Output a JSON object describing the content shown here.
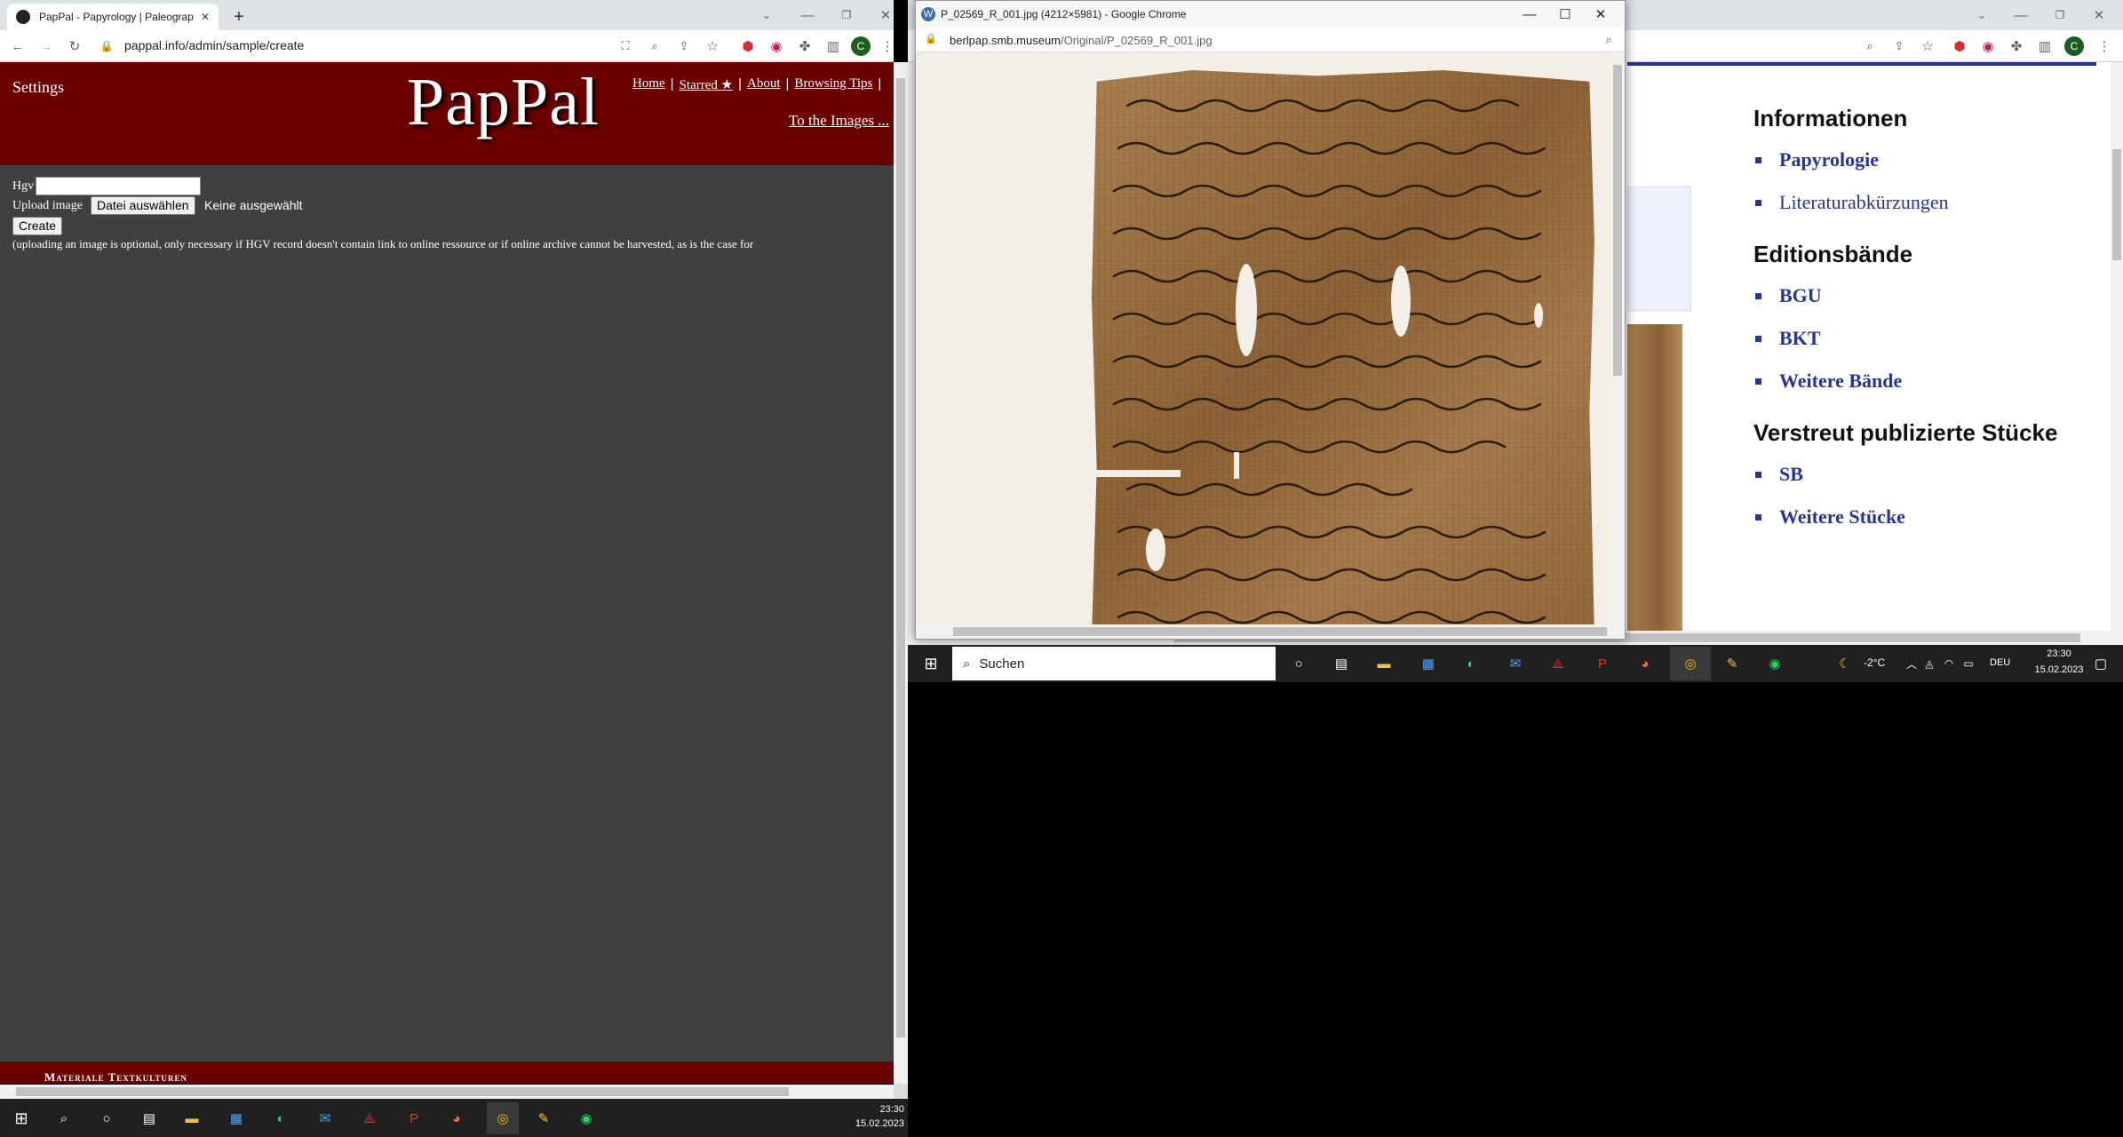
{
  "left_window": {
    "tab_title": "PapPal - Papyrology | Paleograph",
    "url": "pappal.info/admin/sample/create",
    "settings": "Settings",
    "logo": "PapPal",
    "nav": [
      "Home",
      "Starred ★",
      "About",
      "Browsing Tips"
    ],
    "to_images": "To the Images ...",
    "hgv_label": "Hgv",
    "upload_label": "Upload image",
    "file_button": "Datei auswählen",
    "file_none": "Keine ausgewählt",
    "create_button": "Create",
    "note": "(uploading an image is optional, only necessary if HGV record doesn't contain link to online ressource or if online archive cannot be harvested, as is the case for",
    "footer_text": "Materiale Textkulturen",
    "clock_time": "23:30",
    "clock_date": "15.02.2023"
  },
  "popup_window": {
    "title": "P_02569_R_001.jpg (4212×5981) - Google Chrome",
    "url_host": "berlpap.smb.museum",
    "url_path": "/Original/P_02569_R_001.jpg"
  },
  "right_page": {
    "sections": [
      {
        "heading": "Informationen",
        "items": [
          {
            "label": "Papyrologie",
            "bold": true
          },
          {
            "label": "Literaturabkürzungen",
            "bold": false
          }
        ]
      },
      {
        "heading": "Editionsbände",
        "items": [
          {
            "label": "BGU",
            "bold": true
          },
          {
            "label": "BKT",
            "bold": true
          },
          {
            "label": "Weitere Bände",
            "bold": true
          }
        ]
      },
      {
        "heading": "Verstreut publizierte Stücke",
        "items": [
          {
            "label": "SB",
            "bold": true
          },
          {
            "label": "Weitere Stücke",
            "bold": true
          }
        ]
      }
    ]
  },
  "taskbar_right": {
    "search_placeholder": "Suchen",
    "weather": "-2°C",
    "lang": "DEU",
    "clock_time": "23:30",
    "clock_date": "15.02.2023"
  },
  "colors": {
    "maroon": "#6b0000",
    "link": "#283593"
  }
}
